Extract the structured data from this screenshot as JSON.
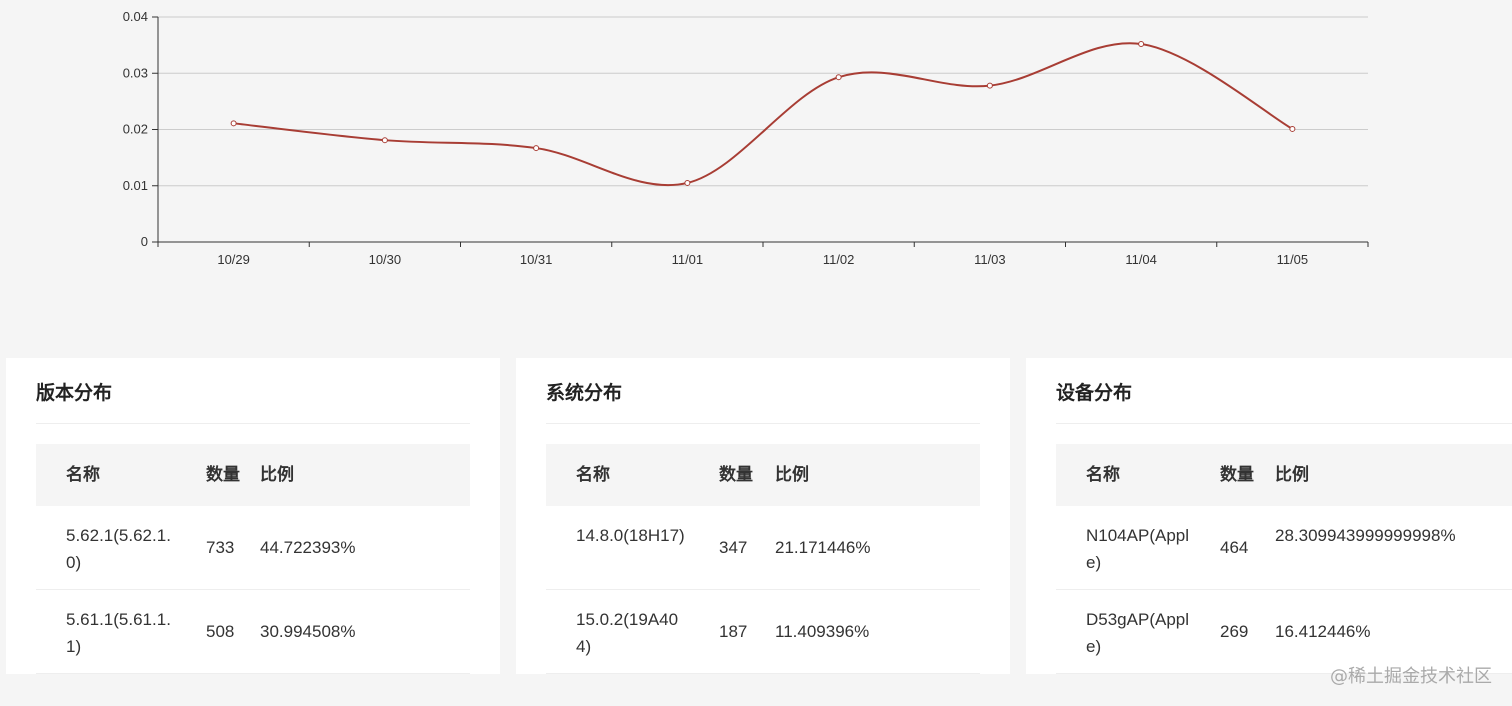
{
  "chart_data": {
    "type": "line",
    "x": [
      "10/29",
      "10/30",
      "10/31",
      "11/01",
      "11/02",
      "11/03",
      "11/04",
      "11/05"
    ],
    "series": [
      {
        "values": [
          0.0211,
          0.0181,
          0.0167,
          0.0105,
          0.0293,
          0.0278,
          0.0352,
          0.0201
        ]
      }
    ],
    "yticks": [
      "0",
      "0.01",
      "0.02",
      "0.03",
      "0.04"
    ],
    "ylim": [
      0,
      0.04
    ],
    "grid": true,
    "line_color": "#a83d34"
  },
  "cards": [
    {
      "title": "版本分布",
      "headers": [
        "名称",
        "数量",
        "比例"
      ],
      "rows": [
        {
          "name": "5.62.1(5.62.1.0)",
          "count": "733",
          "ratio": "44.722393%"
        },
        {
          "name": "5.61.1(5.61.1.1)",
          "count": "508",
          "ratio": "30.994508%"
        }
      ]
    },
    {
      "title": "系统分布",
      "headers": [
        "名称",
        "数量",
        "比例"
      ],
      "rows": [
        {
          "name": "14.8.0(18H17)",
          "count": "347",
          "ratio": "21.171446%"
        },
        {
          "name": "15.0.2(19A404)",
          "count": "187",
          "ratio": "11.409396%"
        }
      ]
    },
    {
      "title": "设备分布",
      "headers": [
        "名称",
        "数量",
        "比例"
      ],
      "rows": [
        {
          "name": "N104AP(Apple)",
          "count": "464",
          "ratio": "28.309943999999998%"
        },
        {
          "name": "D53gAP(Apple)",
          "count": "269",
          "ratio": "16.412446%"
        }
      ]
    }
  ],
  "watermark": "@稀土掘金技术社区"
}
